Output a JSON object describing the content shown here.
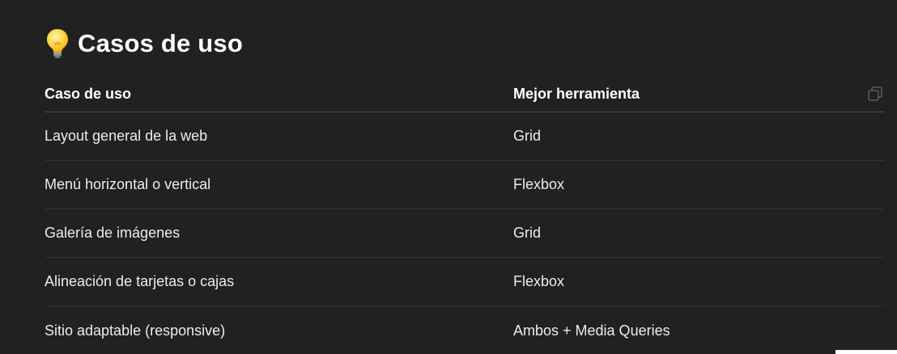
{
  "section": {
    "icon": "lightbulb-icon",
    "title": "Casos de uso"
  },
  "table": {
    "headers": [
      "Caso de uso",
      "Mejor herramienta"
    ],
    "rows": [
      [
        "Layout general de la web",
        "Grid"
      ],
      [
        "Menú horizontal o vertical",
        "Flexbox"
      ],
      [
        "Galería de imágenes",
        "Grid"
      ],
      [
        "Alineación de tarjetas o cajas",
        "Flexbox"
      ],
      [
        "Sitio adaptable (responsive)",
        "Ambos + Media Queries"
      ]
    ],
    "copy_icon": "copy-icon"
  },
  "colors": {
    "background": "#212121",
    "text": "#ececec",
    "divider": "#333333",
    "header_divider": "#4a4a4a"
  }
}
